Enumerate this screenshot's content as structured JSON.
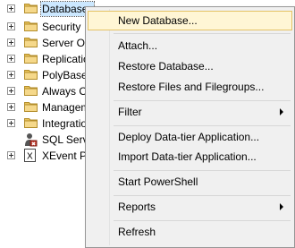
{
  "tree": {
    "nodes": [
      {
        "label": "Databases",
        "icon": "folder-icon",
        "expandable": true,
        "selected": true
      },
      {
        "label": "Security",
        "icon": "folder-icon",
        "expandable": true
      },
      {
        "label": "Server Ob",
        "icon": "folder-icon",
        "expandable": true
      },
      {
        "label": "Replication",
        "icon": "folder-icon",
        "expandable": true
      },
      {
        "label": "PolyBase",
        "icon": "folder-icon",
        "expandable": true
      },
      {
        "label": "Always O",
        "icon": "folder-icon",
        "expandable": true
      },
      {
        "label": "Managem",
        "icon": "folder-icon",
        "expandable": true
      },
      {
        "label": "Integratio",
        "icon": "folder-icon",
        "expandable": true
      },
      {
        "label": "SQL Serve",
        "icon": "sql-agent-icon",
        "expandable": false
      },
      {
        "label": "XEvent Pr",
        "icon": "xevent-icon",
        "expandable": true
      }
    ]
  },
  "context_menu": {
    "items": [
      {
        "label": "New Database...",
        "highlighted": true
      },
      {
        "label": "Attach..."
      },
      {
        "label": "Restore Database..."
      },
      {
        "label": "Restore Files and Filegroups..."
      },
      {
        "label": "Filter",
        "submenu": true
      },
      {
        "label": "Deploy Data-tier Application..."
      },
      {
        "label": "Import Data-tier Application..."
      },
      {
        "label": "Start PowerShell"
      },
      {
        "label": "Reports",
        "submenu": true
      },
      {
        "label": "Refresh"
      }
    ]
  },
  "colors": {
    "selection": "#cce8ff",
    "menu_background": "#f0f0f0",
    "menu_highlight": "#fff6d5",
    "menu_highlight_border": "#e5c365",
    "folder": "#e8c25a"
  }
}
